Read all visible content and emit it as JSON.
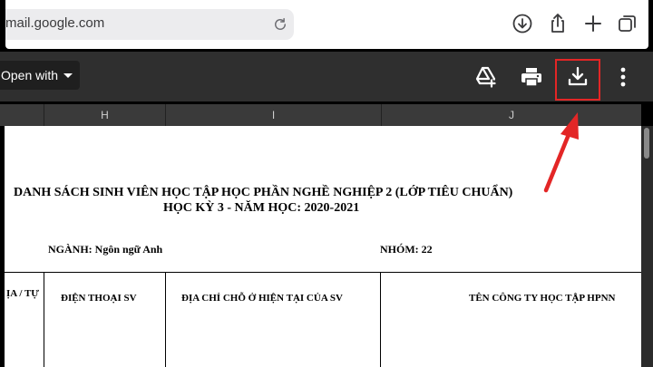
{
  "browser": {
    "url": "mail.google.com",
    "icons": [
      "reload-icon",
      "download-icon",
      "share-icon",
      "new-tab-icon",
      "tabs-icon"
    ]
  },
  "viewer": {
    "open_with_label": "Open with",
    "icons": [
      "add-to-drive-icon",
      "print-icon",
      "download-icon",
      "more-options-icon"
    ],
    "highlight_color": "#e32626"
  },
  "sheet": {
    "columns": [
      "",
      "H",
      "I",
      "J"
    ]
  },
  "document": {
    "title_line1": "DANH SÁCH SINH VIÊN HỌC TẬP HỌC PHẦN NGHỀ NGHIỆP 2 (LỚP TIÊU CHUẨN)",
    "title_line2": "HỌC KỲ 3 - NĂM HỌC: 2020-2021",
    "nganh": "NGÀNH: Ngôn ngữ Anh",
    "nhom": "NHÓM:  22",
    "table_headers": [
      "ỊA / TỰ",
      "ĐIỆN THOẠI SV",
      "ĐỊA CHỈ CHỖ Ở HIỆN TẠI CỦA SV",
      "TÊN CÔNG TY HỌC TẬP HPNN"
    ]
  }
}
